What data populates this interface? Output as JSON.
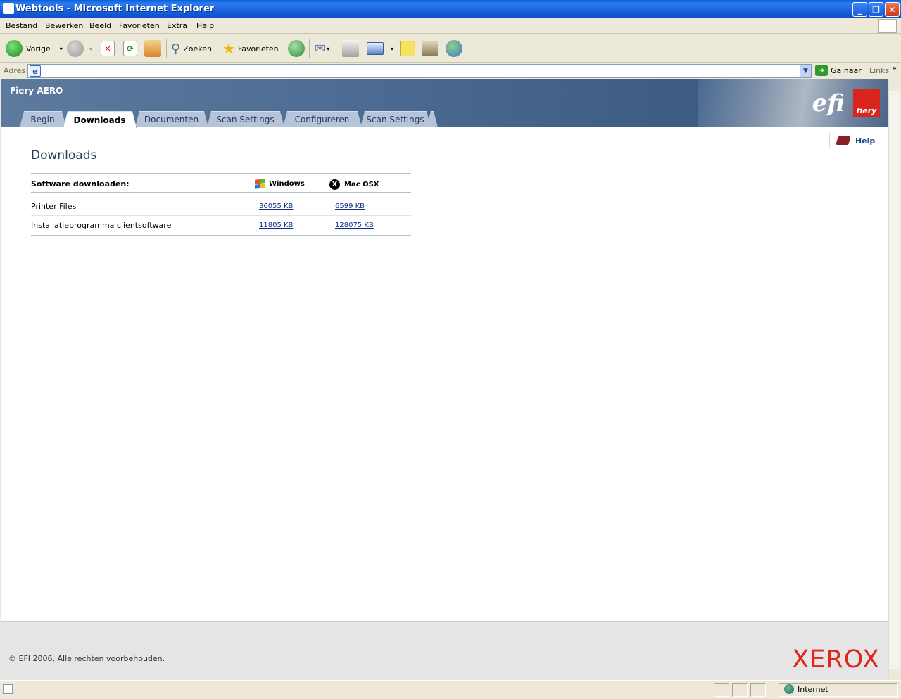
{
  "window": {
    "title": "Webtools - Microsoft Internet Explorer"
  },
  "menu": [
    "Bestand",
    "Bewerken",
    "Beeld",
    "Favorieten",
    "Extra",
    "Help"
  ],
  "toolbar": {
    "back": "Vorige",
    "search": "Zoeken",
    "favorites": "Favorieten"
  },
  "address": {
    "label": "Adres",
    "value": "",
    "go": "Ga naar",
    "links": "Links"
  },
  "banner": {
    "product": "Fiery AERO",
    "tabs": [
      "Begin",
      "Downloads",
      "Documenten",
      "Scan Settings",
      "Configureren",
      "Scan Settings"
    ],
    "active_tab": "Downloads",
    "efi_logo": "efi",
    "fiery_logo": "fiery"
  },
  "help": {
    "label": "Help"
  },
  "page": {
    "title": "Downloads",
    "table": {
      "header": "Software downloaden:",
      "col_windows": "Windows",
      "col_mac": "Mac OSX",
      "rows": [
        {
          "label": "Printer Files",
          "windows": "36055 KB",
          "mac": "6599 KB"
        },
        {
          "label": "Installatieprogramma clientsoftware",
          "windows": "11805 KB",
          "mac": "128075 KB"
        }
      ]
    }
  },
  "footer": {
    "copyright": "© EFI 2006, Alle rechten voorbehouden.",
    "brand": "XEROX"
  },
  "status": {
    "zone": "Internet"
  },
  "colors": {
    "banner": "#4a6a92",
    "tab": "#b5c4d8",
    "link": "#0b2f8a",
    "xerox_red": "#e0251b"
  }
}
